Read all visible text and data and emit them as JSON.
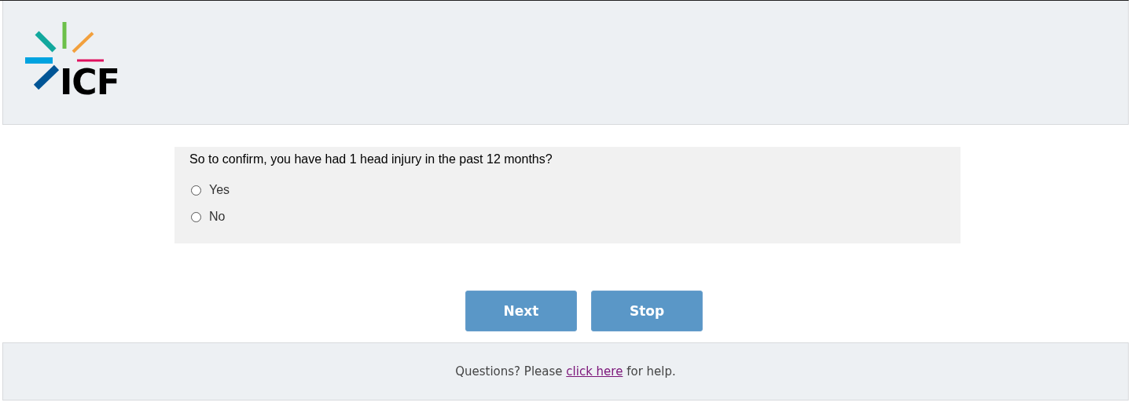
{
  "header": {
    "logo_text": "ICF"
  },
  "question": {
    "text": "So to confirm, you have had 1 head injury in the past 12 months?",
    "options": [
      {
        "label": "Yes",
        "selected": false
      },
      {
        "label": "No",
        "selected": false
      }
    ]
  },
  "buttons": [
    "Next",
    "Stop"
  ],
  "footer": {
    "before": "Questions? Please",
    "link": "click here",
    "after": "for help."
  }
}
